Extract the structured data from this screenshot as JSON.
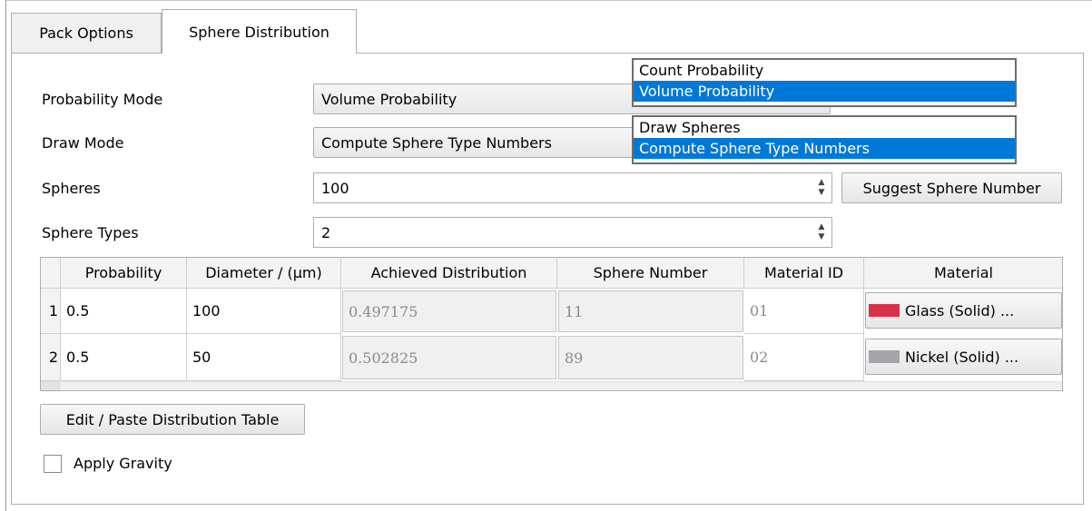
{
  "tabs": [
    {
      "label": "Pack Options"
    },
    {
      "label": "Sphere Distribution"
    }
  ],
  "form": {
    "probability_mode": {
      "label": "Probability Mode",
      "value": "Volume Probability"
    },
    "draw_mode": {
      "label": "Draw Mode",
      "value": "Compute Sphere Type Numbers"
    },
    "spheres": {
      "label": "Spheres",
      "value": "100"
    },
    "sphere_types": {
      "label": "Sphere Types",
      "value": "2"
    },
    "suggest_button": "Suggest Sphere Number"
  },
  "popups": {
    "probability_options": [
      "Count Probability",
      "Volume Probability"
    ],
    "probability_selected": "Volume Probability",
    "draw_options": [
      "Draw Spheres",
      "Compute Sphere Type Numbers"
    ],
    "draw_selected": "Compute Sphere Type Numbers"
  },
  "table": {
    "headers": [
      "Probability",
      "Diameter / (μm)",
      "Achieved Distribution",
      "Sphere Number",
      "Material ID",
      "Material"
    ],
    "rows": [
      {
        "index": "1",
        "probability": "0.5",
        "diameter": "100",
        "achieved": "0.497175",
        "sphere_number": "11",
        "material_id": "01",
        "material": "Glass (Solid) ...",
        "material_color": "#d9304a"
      },
      {
        "index": "2",
        "probability": "0.5",
        "diameter": "50",
        "achieved": "0.502825",
        "sphere_number": "89",
        "material_id": "02",
        "material": "Nickel (Solid) ...",
        "material_color": "#a5a5a9"
      }
    ]
  },
  "edit_button": "Edit / Paste Distribution Table",
  "apply_gravity": {
    "label": "Apply Gravity",
    "checked": false
  }
}
